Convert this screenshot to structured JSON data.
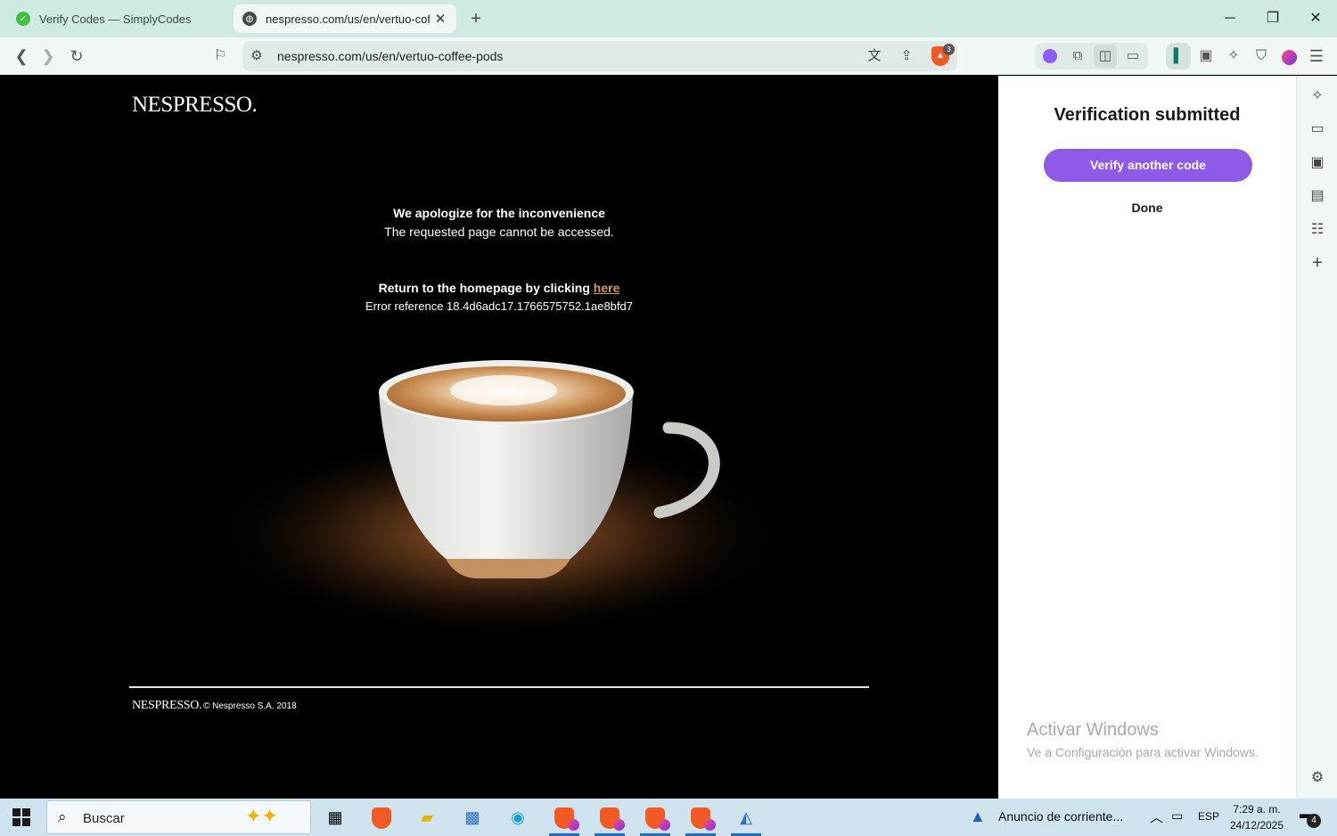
{
  "browser": {
    "tabs": [
      {
        "title": "Verify Codes — SimplyCodes",
        "active": false
      },
      {
        "title": "nespresso.com/us/en/vertuo-cof",
        "active": true
      }
    ],
    "url": "nespresso.com/us/en/vertuo-coffee-pods",
    "shield_count": "3"
  },
  "page": {
    "logo": "NESPRESSO.",
    "title": "We apologize for the inconvenience",
    "subtitle": "The requested page cannot be accessed.",
    "return_text": "Return to the homepage by clicking ",
    "return_link": "here",
    "error_reference": "Error reference 18.4d6adc17.1766575752.1ae8bfd7",
    "footer_logo": "NESPRESSO.",
    "footer_copyright": "© Nespresso S.A.  2018"
  },
  "side_panel": {
    "title": "Verification submitted",
    "primary_button": "Verify another code",
    "secondary_button": "Done",
    "watermark_title": "Activar Windows",
    "watermark_sub": "Ve a Configuración para activar Windows."
  },
  "taskbar": {
    "search_placeholder": "Buscar",
    "notification_text": "Anuncio de corriente...",
    "language": "ESP",
    "time": "7:29 a. m.",
    "date": "24/12/2025",
    "notification_count": "4"
  },
  "colors": {
    "accent_purple": "#8f5ae8",
    "link_gold": "#d59a5a",
    "brave_orange": "#f15a24",
    "tab_strip": "#cfe9e3"
  }
}
